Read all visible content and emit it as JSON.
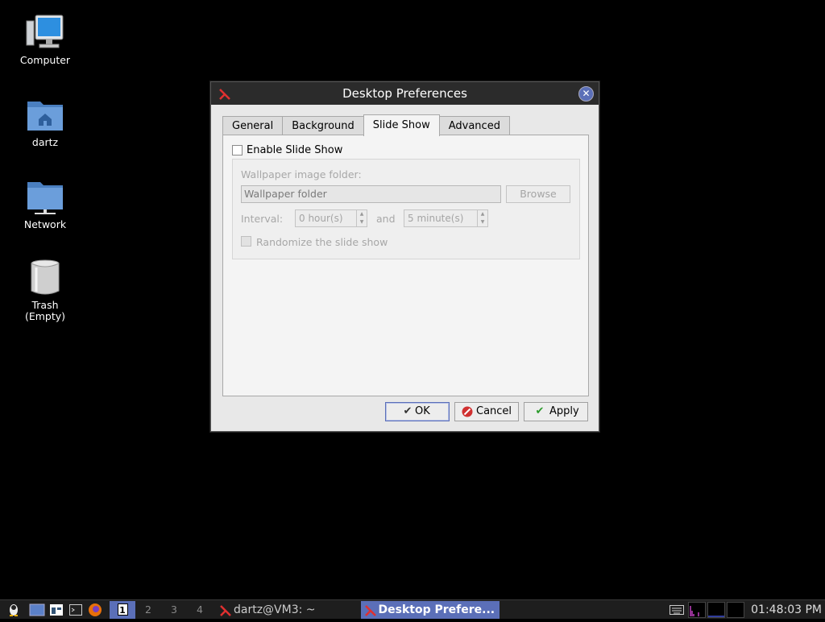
{
  "desktop": {
    "icons": [
      {
        "label": "Computer"
      },
      {
        "label": "dartz"
      },
      {
        "label": "Network"
      },
      {
        "label": "Trash\n(Empty)"
      }
    ]
  },
  "dialog": {
    "title": "Desktop Preferences",
    "tabs": [
      "General",
      "Background",
      "Slide Show",
      "Advanced"
    ],
    "active_tab": "Slide Show",
    "enable_slideshow_label": "Enable Slide Show",
    "enable_slideshow_checked": false,
    "folder_label": "Wallpaper image folder:",
    "folder_value": "Wallpaper folder",
    "browse_label": "Browse",
    "interval_label": "Interval:",
    "hours_value": "0 hour(s)",
    "and_label": "and",
    "minutes_value": "5 minute(s)",
    "randomize_label": "Randomize the slide show",
    "ok_label": "OK",
    "cancel_label": "Cancel",
    "apply_label": "Apply"
  },
  "taskbar": {
    "workspaces": [
      "1",
      "2",
      "3",
      "4"
    ],
    "active_workspace": "1",
    "tasks": [
      {
        "label": "dartz@VM3: ~",
        "active": false
      },
      {
        "label": "Desktop Prefere...",
        "active": true
      }
    ],
    "clock": "01:48:03 PM"
  },
  "colors": {
    "accent": "#5b6fb8",
    "titlebar": "#2b2b2b",
    "desktop_bg": "#000000"
  }
}
